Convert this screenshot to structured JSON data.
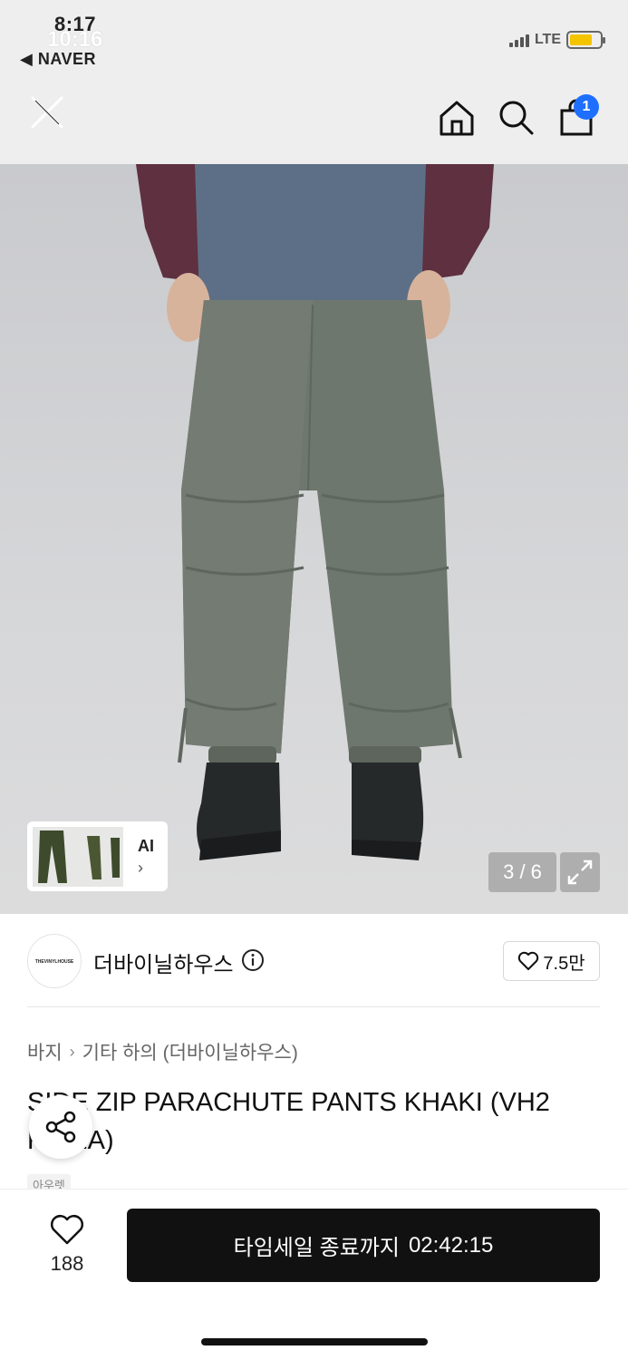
{
  "status_bar": {
    "time_back": "8:17",
    "time": "10:16",
    "back_app": "◀ NAVER",
    "network": "LTE",
    "battery_level": 0.75,
    "battery_color": "#f5c400"
  },
  "header": {
    "cart_count": "1",
    "badge_color": "#1f6fff"
  },
  "gallery": {
    "ai_label": "AI",
    "ai_chevron": "›",
    "page_indicator": "3 / 6"
  },
  "store": {
    "logo_text": "THEVINYLHOUSE",
    "name": "더바이닐하우스",
    "favorites": "7.5만"
  },
  "product": {
    "breadcrumb": [
      "바지",
      "기타 하의 (더바이닐하우스)"
    ],
    "title": "SIDE ZIP PARACHUTE PANTS KHAKI (VH2 PA11A)",
    "tag": "아우렛"
  },
  "purchase_bar": {
    "wish_count": "188",
    "buy_label": "타임세일 종료까지",
    "countdown": "02:42:15"
  }
}
